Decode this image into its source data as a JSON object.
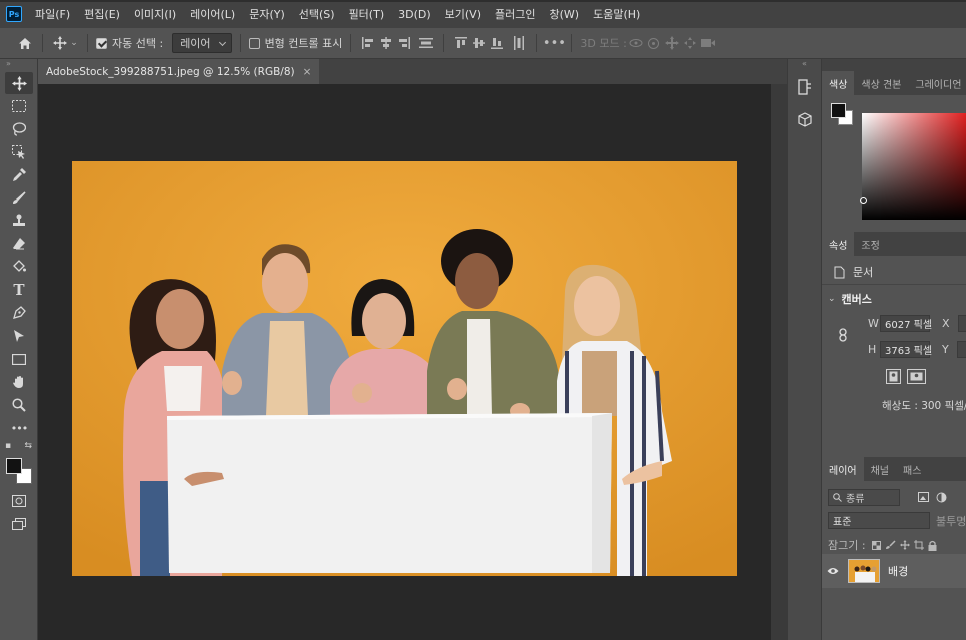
{
  "app": {
    "logo_text": "Ps"
  },
  "menu": [
    "파일(F)",
    "편집(E)",
    "이미지(I)",
    "레이어(L)",
    "문자(Y)",
    "선택(S)",
    "필터(T)",
    "3D(D)",
    "보기(V)",
    "플러그인",
    "창(W)",
    "도움말(H)"
  ],
  "options": {
    "auto_select_label": "자동 선택 :",
    "auto_select_checked": true,
    "auto_select_value": "레이어",
    "transform_controls_label": "변형 컨트롤 표시",
    "transform_controls_checked": false,
    "mode_3d_label": "3D 모드 :"
  },
  "document": {
    "tab_title": "AdobeStock_399288751.jpeg @ 12.5% (RGB/8)",
    "close_glyph": "×"
  },
  "color_panel": {
    "tabs": [
      "색상",
      "색상 견본",
      "그레이디언"
    ],
    "active_tab": 0,
    "foreground": "#111111",
    "background": "#ffffff",
    "hue": "#e02020"
  },
  "properties_panel": {
    "tabs": [
      "속성",
      "조정"
    ],
    "active_tab": 0,
    "kind_label": "문서",
    "section_title": "캔버스",
    "w_label": "W",
    "w_value": "6027 픽셀",
    "h_label": "H",
    "h_value": "3763 픽셀",
    "x_label": "X",
    "y_label": "Y",
    "resolution": "해상도 : 300 픽셀/"
  },
  "layers_panel": {
    "tabs": [
      "레이어",
      "채널",
      "패스"
    ],
    "active_tab": 0,
    "filter_label": "종류",
    "blend_mode": "표준",
    "opacity_label": "불투명",
    "lock_label": "잠그기 :",
    "layers": [
      {
        "name": "배경",
        "visible": true
      }
    ]
  },
  "colors": {
    "canvas_bg": "#e9a233",
    "board": "#f1f1f1",
    "workspace": "#282828"
  }
}
